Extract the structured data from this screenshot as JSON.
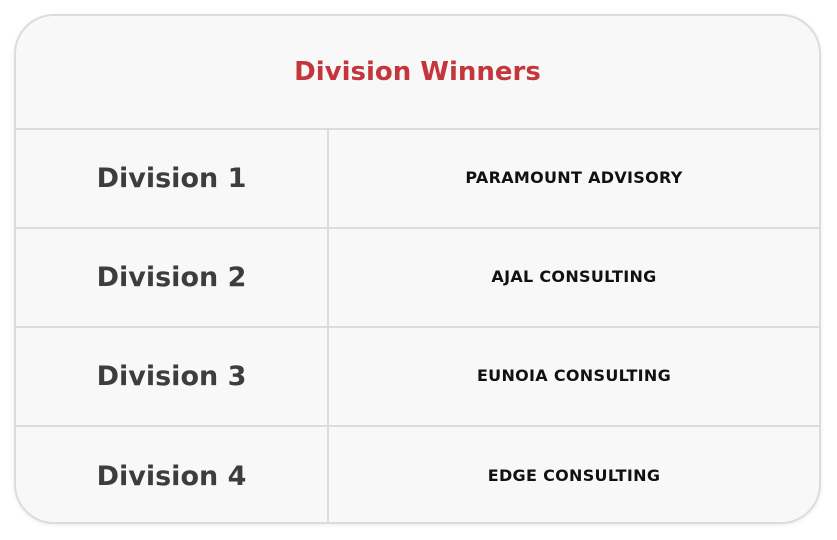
{
  "title": "Division Winners",
  "colors": {
    "title": "#c2363c",
    "border": "#dcdcdc",
    "background": "#f8f8f8",
    "division_text": "#3d3d3d",
    "winner_text": "#111111"
  },
  "rows": [
    {
      "division": "Division 1",
      "winner": "PARAMOUNT ADVISORY"
    },
    {
      "division": "Division 2",
      "winner": "AJAL CONSULTING"
    },
    {
      "division": "Division 3",
      "winner": "EUNOIA CONSULTING"
    },
    {
      "division": "Division 4",
      "winner": "EDGE CONSULTING"
    }
  ]
}
